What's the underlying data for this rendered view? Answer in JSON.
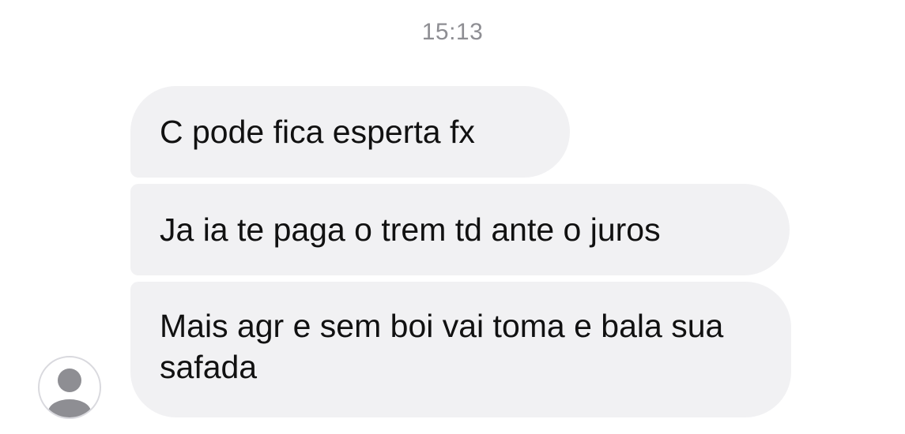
{
  "conversation": {
    "timestamp": "15:13",
    "messages": [
      {
        "text": "C pode fica esperta fx"
      },
      {
        "text": "Ja ia te paga o trem td ante o juros"
      },
      {
        "text": "Mais agr e sem boi vai toma e bala sua safada"
      }
    ]
  },
  "sender": {
    "avatar_icon": "default-user-avatar-icon"
  },
  "colors": {
    "bubble_background": "#f1f1f3",
    "timestamp_text": "#8e8e93",
    "message_text": "#111111",
    "avatar_silhouette": "#8e8e93"
  }
}
